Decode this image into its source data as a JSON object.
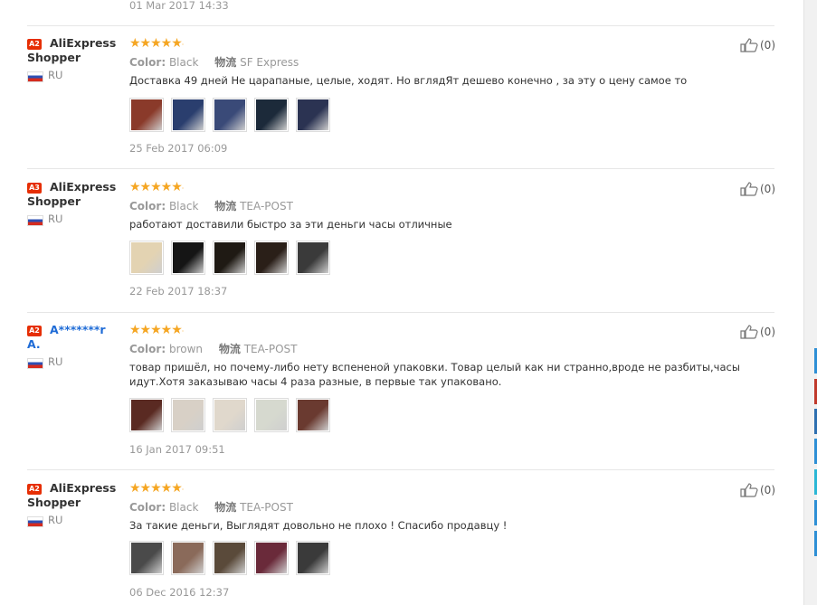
{
  "top": {
    "date": "01 Mar 2017 14:33"
  },
  "labels": {
    "color": "Color:",
    "shipping": "物流"
  },
  "reviews": [
    {
      "level": "A2",
      "name": "AliExpress Shopper",
      "country": "RU",
      "color": "Black",
      "shipping": "SF Express",
      "text": "Доставка 49 дней Не царапаные, целые, ходят. Но вглядЯт дешево конечно , за эту о цену самое то",
      "date": "25 Feb 2017 06:09",
      "helpful": "(0)",
      "thumbs": [
        "#8a3a2a",
        "#2a3e6e",
        "#3a4a78",
        "#1c2a3a",
        "#2b3352"
      ]
    },
    {
      "level": "A3",
      "name": "AliExpress Shopper",
      "country": "RU",
      "color": "Black",
      "shipping": "TEA-POST",
      "text": "работают доставили быстро за эти деньги часы отличные",
      "date": "22 Feb 2017 18:37",
      "helpful": "(0)",
      "thumbs": [
        "#e3d3b2",
        "#151515",
        "#1f1a14",
        "#2a1f18",
        "#3a3a3a"
      ]
    },
    {
      "level": "A2",
      "name": "A*******r A.",
      "country": "RU",
      "color": "brown",
      "shipping": "TEA-POST",
      "text": "товар пришёл, но почему-либо нету вспененой упаковки. Товар целый как ни странно,вроде не разбиты,часы идут.Хотя заказываю часы 4 раза разные, в первые так упаковано.",
      "date": "16 Jan 2017 09:51",
      "helpful": "(0)",
      "thumbs": [
        "#5a2a22",
        "#d8d0c6",
        "#e0d8cc",
        "#d6d9cf",
        "#6a3a30"
      ]
    },
    {
      "level": "A2",
      "name": "AliExpress Shopper",
      "country": "RU",
      "color": "Black",
      "shipping": "TEA-POST",
      "text": "За такие деньги, Выглядят довольно не плохо ! Спасибо продавцу !",
      "date": "06 Dec 2016 12:37",
      "helpful": "(0)",
      "thumbs": [
        "#4a4a4a",
        "#8a6a5a",
        "#5a4a3a",
        "#6a2a3a",
        "#3a3a3a"
      ]
    }
  ],
  "side_colors": [
    "#2d8fd5",
    "#c0392b",
    "#2d6fb0",
    "#2d8fd5",
    "#2ab7d5",
    "#2d8fd5",
    "#2d8fd5"
  ]
}
